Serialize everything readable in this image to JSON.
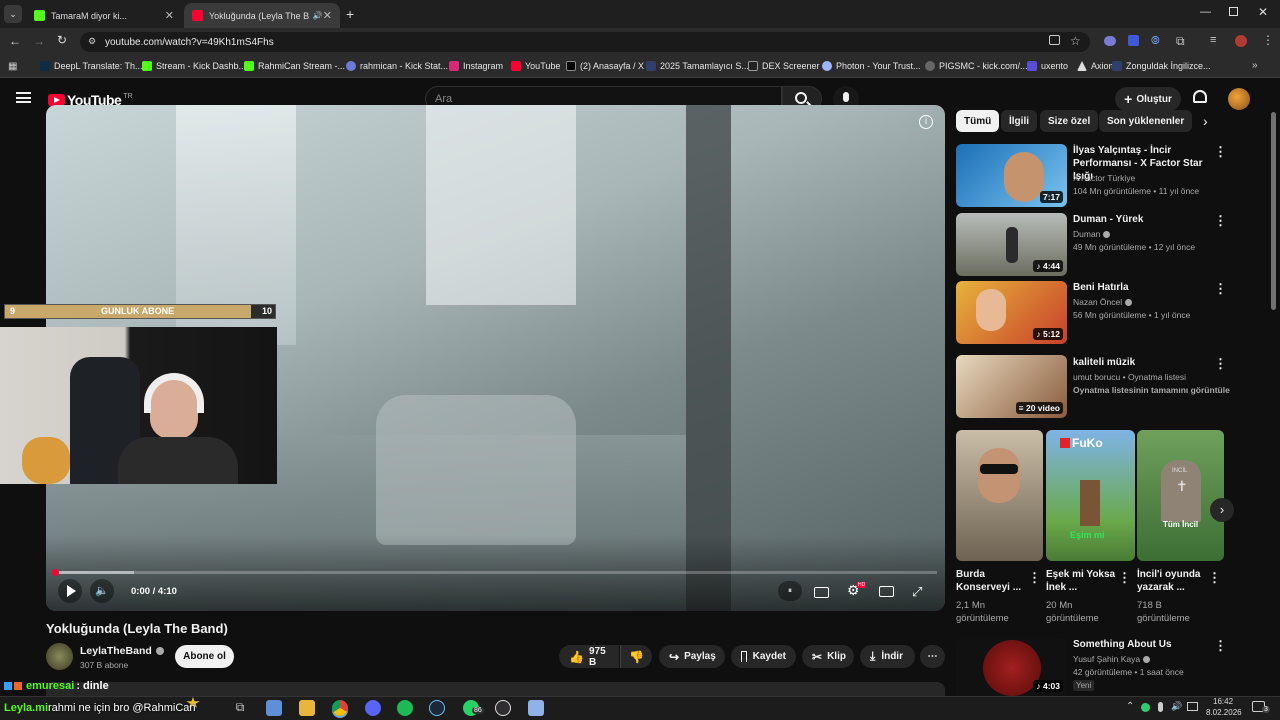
{
  "browser": {
    "tabs": [
      {
        "title": "TamaraM diyor ki..."
      },
      {
        "title": "Yokluğunda (Leyla The Band)"
      }
    ],
    "new_tab_icon": "plus-icon",
    "url": "youtube.com/watch?v=49Kh1mS4Fhs",
    "bookmarks": [
      {
        "label": "DeepL Translate: Th..."
      },
      {
        "label": "Stream - Kick Dashb..."
      },
      {
        "label": "RahmiCan Stream -..."
      },
      {
        "label": "rahmican - Kick Stat..."
      },
      {
        "label": "Instagram"
      },
      {
        "label": "YouTube"
      },
      {
        "label": "(2) Anasayfa / X"
      },
      {
        "label": "2025 Tamamlayıcı S..."
      },
      {
        "label": "DEX Screener"
      },
      {
        "label": "Photon - Your Trust..."
      },
      {
        "label": "PIGSMC - kick.com/..."
      },
      {
        "label": "uxento"
      },
      {
        "label": "Axiom"
      },
      {
        "label": "Zonguldak İngilizce..."
      }
    ]
  },
  "youtube": {
    "logo_text": "YouTube",
    "region": "TR",
    "search_placeholder": "Ara",
    "create_label": "Oluştur",
    "chips": [
      "Tümü",
      "İlgili",
      "Size özel",
      "Son yüklenenler"
    ],
    "video": {
      "title": "Yokluğunda (Leyla The Band)",
      "time": "0:00 / 4:10",
      "progress": 0.0
    },
    "channel": {
      "name": "LeylaTheBand",
      "subscribers": "307 B abone",
      "subscribe_label": "Abone ol"
    },
    "actions": {
      "likes": "975 B",
      "share": "Paylaş",
      "save": "Kaydet",
      "clip": "Klip",
      "download": "İndir"
    },
    "recommendations": [
      {
        "title": "İlyas Yalçıntaş - İncir Performansı - X Factor Star Işığı",
        "channel": "X Factor Türkiye",
        "meta": "104 Mn görüntüleme • 11 yıl önce",
        "duration": "7:17"
      },
      {
        "title": "Duman - Yürek",
        "channel": "Duman",
        "meta": "49 Mn görüntüleme • 12 yıl önce",
        "duration": "4:44"
      },
      {
        "title": "Beni Hatırla",
        "channel": "Nazan Öncel",
        "meta": "56 Mn görüntüleme • 1 yıl önce",
        "duration": "5:12"
      },
      {
        "title": "kaliteli müzik",
        "channel": "umut borucu • Oynatma listesi",
        "meta": "Oynatma listesinin tamamını görüntüle",
        "duration": "20 video"
      }
    ],
    "shorts": [
      {
        "title": "Burda Konserveyi ...",
        "views": "2,1 Mn görüntüleme"
      },
      {
        "title": "Eşek mi Yoksa İnek ...",
        "views": "20 Mn görüntüleme"
      },
      {
        "title": "İncil'i oyunda yazarak ...",
        "views": "718 B görüntüleme"
      }
    ],
    "shorts_text": {
      "fuko": "FuKo",
      "esim": "Eşim mi",
      "incil": "İNCİL",
      "tum_incil": "Tüm İncil"
    },
    "last_rec": {
      "title": "Something About Us",
      "channel": "Yusuf Şahin Kaya",
      "meta": "42 görüntüleme • 1 saat önce",
      "badge": "Yeni",
      "duration": "4:03"
    }
  },
  "overlay": {
    "sub_goal_label": "GUNLUK ABONE",
    "sub_current": "9",
    "sub_target": "10",
    "chat_user": "emuresai",
    "chat_message": ": dinle",
    "chat_line2": "rahmi ne için bro @RahmiCan",
    "chat_ghost": "Leyla.mi"
  },
  "taskbar": {
    "time": "16:42",
    "date": "8.02.2026",
    "notifications": "3",
    "whatsapp_badge": "86"
  }
}
